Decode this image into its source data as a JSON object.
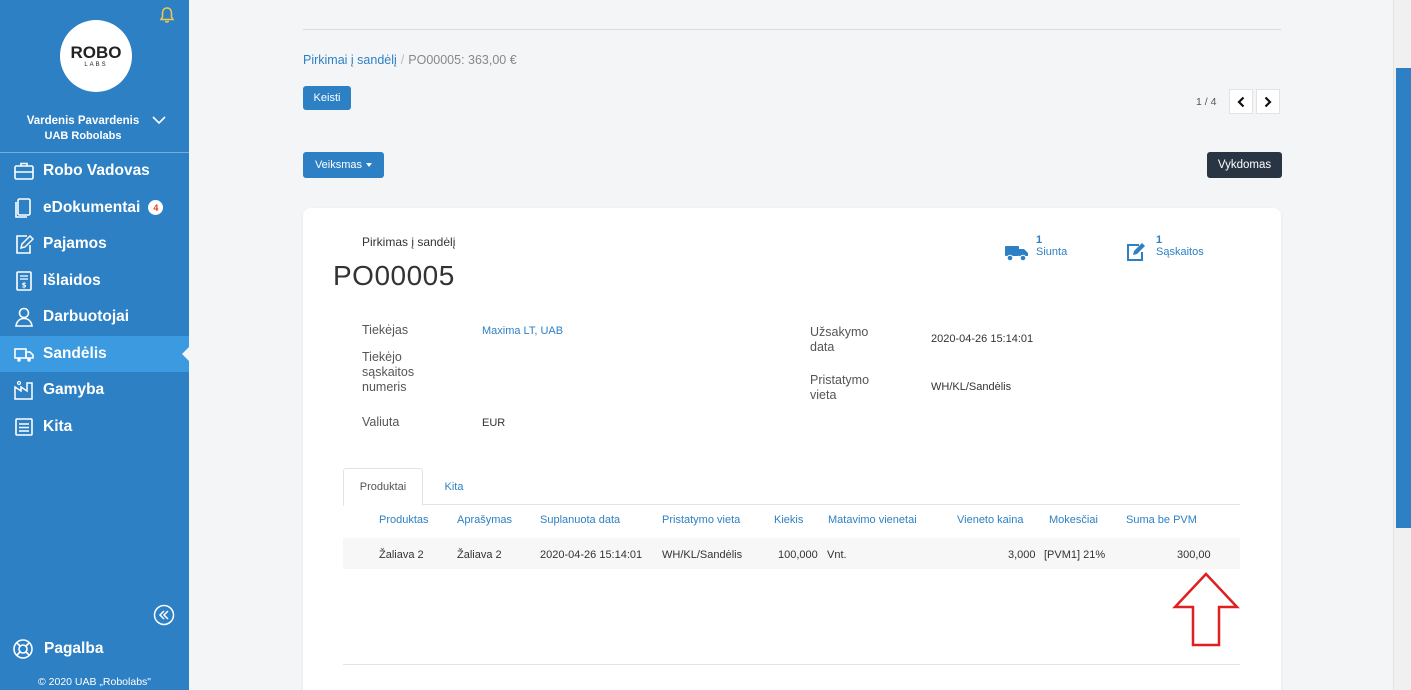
{
  "sidebar": {
    "logo_main": "ROBO",
    "logo_sub": "LABS",
    "user_name": "Vardenis Pavardenis",
    "company": "UAB Robolabs",
    "items": [
      {
        "label": "Robo Vadovas",
        "icon": "briefcase-icon"
      },
      {
        "label": "eDokumentai",
        "icon": "documents-icon",
        "badge": "4"
      },
      {
        "label": "Pajamos",
        "icon": "edit-document-icon"
      },
      {
        "label": "Išlaidos",
        "icon": "receipt-icon"
      },
      {
        "label": "Darbuotojai",
        "icon": "person-icon"
      },
      {
        "label": "Sandėlis",
        "icon": "truck-icon",
        "active": true
      },
      {
        "label": "Gamyba",
        "icon": "factory-icon"
      },
      {
        "label": "Kita",
        "icon": "list-icon"
      }
    ],
    "help_label": "Pagalba",
    "copyright": "© 2020 UAB „Robolabs\""
  },
  "breadcrumb": {
    "parent": "Pirkimai į sandėlį",
    "separator": "/",
    "current": "PO00005: 363,00 €"
  },
  "toolbar": {
    "edit_label": "Keisti",
    "action_label": "Veiksmas",
    "pager": "1 / 4",
    "status": "Vykdomas"
  },
  "document": {
    "type_label": "Pirkimas į sandėlį",
    "number": "PO00005",
    "stats": {
      "shipments_count": "1",
      "shipments_label": "Siunta",
      "invoices_count": "1",
      "invoices_label": "Sąskaitos"
    },
    "fields": {
      "supplier_label": "Tiekėjas",
      "supplier_value": "Maxima LT, UAB",
      "supplier_invoice_label_1": "Tiekėjo",
      "supplier_invoice_label_2": "sąskaitos",
      "supplier_invoice_label_3": "numeris",
      "currency_label": "Valiuta",
      "currency_value": "EUR",
      "order_date_label_1": "Užsakymo",
      "order_date_label_2": "data",
      "order_date_value": "2020-04-26 15:14:01",
      "delivery_label_1": "Pristatymo",
      "delivery_label_2": "vieta",
      "delivery_value": "WH/KL/Sandėlis"
    }
  },
  "tabs": [
    {
      "label": "Produktai",
      "active": true
    },
    {
      "label": "Kita",
      "active": false
    }
  ],
  "table": {
    "columns": [
      "Produktas",
      "Aprašymas",
      "Suplanuota data",
      "Pristatymo vieta",
      "Kiekis",
      "Matavimo vienetai",
      "Vieneto kaina",
      "Mokesčiai",
      "Suma be PVM"
    ],
    "rows": [
      [
        "Žaliava 2",
        "Žaliava 2",
        "2020-04-26 15:14:01",
        "WH/KL/Sandėlis",
        "100,000",
        "Vnt.",
        "3,000",
        "[PVM1] 21%",
        "300,00"
      ]
    ]
  },
  "colors": {
    "brand_blue": "#2d80c4",
    "sidebar_active": "#3b9ae0",
    "status_dark": "#2a3543",
    "annotation_red": "#e02020"
  }
}
